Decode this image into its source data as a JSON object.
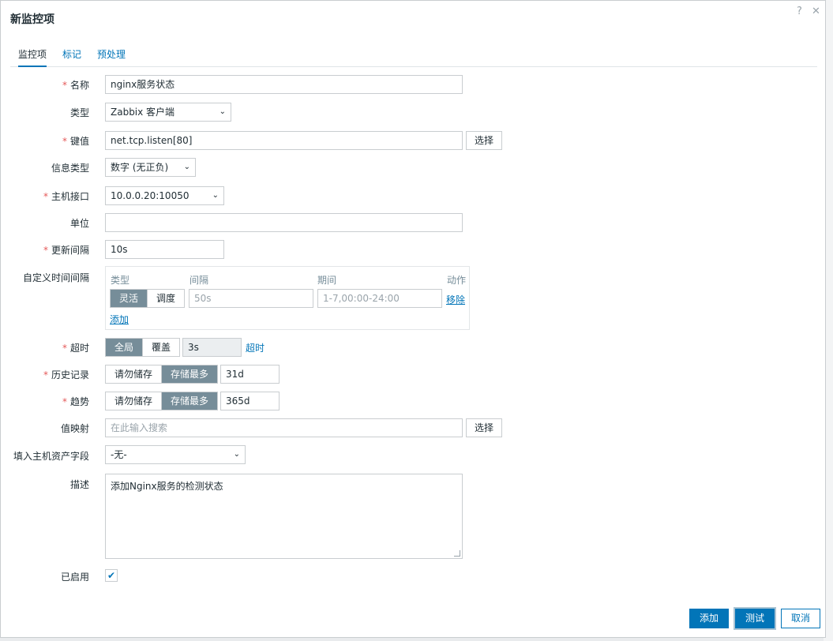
{
  "dialog": {
    "title": "新监控项"
  },
  "header": {
    "help_glyph": "?",
    "close_glyph": "✕"
  },
  "tabs": [
    {
      "label": "监控项",
      "active": true
    },
    {
      "label": "标记",
      "active": false
    },
    {
      "label": "预处理",
      "active": false
    }
  ],
  "required_mark": "*",
  "fields": {
    "name": {
      "label": "名称",
      "value": "nginx服务状态"
    },
    "type": {
      "label": "类型",
      "value": "Zabbix 客户端"
    },
    "key": {
      "label": "键值",
      "value": "net.tcp.listen[80]",
      "select_label": "选择"
    },
    "info_type": {
      "label": "信息类型",
      "value": "数字 (无正负)"
    },
    "host_interface": {
      "label": "主机接口",
      "value": "10.0.0.20:10050"
    },
    "units": {
      "label": "单位",
      "value": ""
    },
    "update_interval": {
      "label": "更新间隔",
      "value": "10s"
    },
    "custom_intervals": {
      "label": "自定义时间间隔",
      "col_type": "类型",
      "col_interval": "间隔",
      "col_period": "期间",
      "col_action": "动作",
      "mode_flexible": "灵活",
      "mode_scheduling": "调度",
      "interval_placeholder": "50s",
      "period_placeholder": "1-7,00:00-24:00",
      "remove_label": "移除",
      "add_label": "添加"
    },
    "timeout": {
      "label": "超时",
      "global": "全局",
      "override": "覆盖",
      "value": "3s",
      "link": "超时"
    },
    "history": {
      "label": "历史记录",
      "do_not_store": "请勿储存",
      "store_up_to": "存储最多",
      "value": "31d"
    },
    "trends": {
      "label": "趋势",
      "do_not_store": "请勿储存",
      "store_up_to": "存储最多",
      "value": "365d"
    },
    "value_map": {
      "label": "值映射",
      "placeholder": "在此输入搜索",
      "select_label": "选择"
    },
    "inventory_field": {
      "label": "填入主机资产字段",
      "value": "-无-"
    },
    "description": {
      "label": "描述",
      "value": "添加Nginx服务的检测状态"
    },
    "enabled": {
      "label": "已启用",
      "checked": true,
      "check_glyph": "✔"
    }
  },
  "chevron_glyph": "⌄",
  "footer": {
    "add_label": "添加",
    "test_label": "测试",
    "cancel_label": "取消"
  },
  "colors": {
    "accent": "#0275b8",
    "required": "#e45959",
    "toggle_on": "#768d99"
  }
}
